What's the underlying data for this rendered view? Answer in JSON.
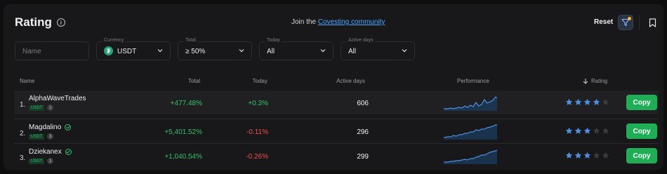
{
  "header": {
    "title": "Rating",
    "join_prefix": "Join the",
    "join_link": "Covesting community",
    "reset_label": "Reset"
  },
  "filters": {
    "name_placeholder": "Name",
    "currency": {
      "label": "Currency",
      "value": "USDT"
    },
    "total": {
      "label": "Total",
      "value": "≥ 50%"
    },
    "today": {
      "label": "Today",
      "value": "All"
    },
    "active_days": {
      "label": "Active days",
      "value": "All"
    }
  },
  "table": {
    "columns": {
      "name": "Name",
      "total": "Total",
      "today": "Today",
      "active_days": "Active days",
      "performance": "Performance",
      "rating": "Rating"
    },
    "rows": [
      {
        "rank": "1.",
        "name": "AlphaWaveTrades",
        "verified": false,
        "currency": "USDT",
        "count": "1",
        "total": "+477.48%",
        "today": "+0.3%",
        "today_sign": "pos",
        "active_days": "606",
        "stars": 4,
        "copy_label": "Copy"
      },
      {
        "rank": "2.",
        "name": "Magdalino",
        "verified": true,
        "currency": "USDT",
        "count": "3",
        "total": "+5,401.52%",
        "today": "-0.11%",
        "today_sign": "neg",
        "active_days": "296",
        "stars": 3,
        "copy_label": "Copy"
      },
      {
        "rank": "3.",
        "name": "Dziekanex",
        "verified": true,
        "currency": "USDT",
        "count": "1",
        "total": "+1,040.54%",
        "today": "-0.26%",
        "today_sign": "neg",
        "active_days": "299",
        "stars": 3,
        "copy_label": "Copy"
      }
    ]
  },
  "colors": {
    "positive": "#36c06a",
    "negative": "#f0504f",
    "star_active": "#4a90e2",
    "star_inactive": "#3a3a40",
    "copy_button": "#1fae55"
  }
}
